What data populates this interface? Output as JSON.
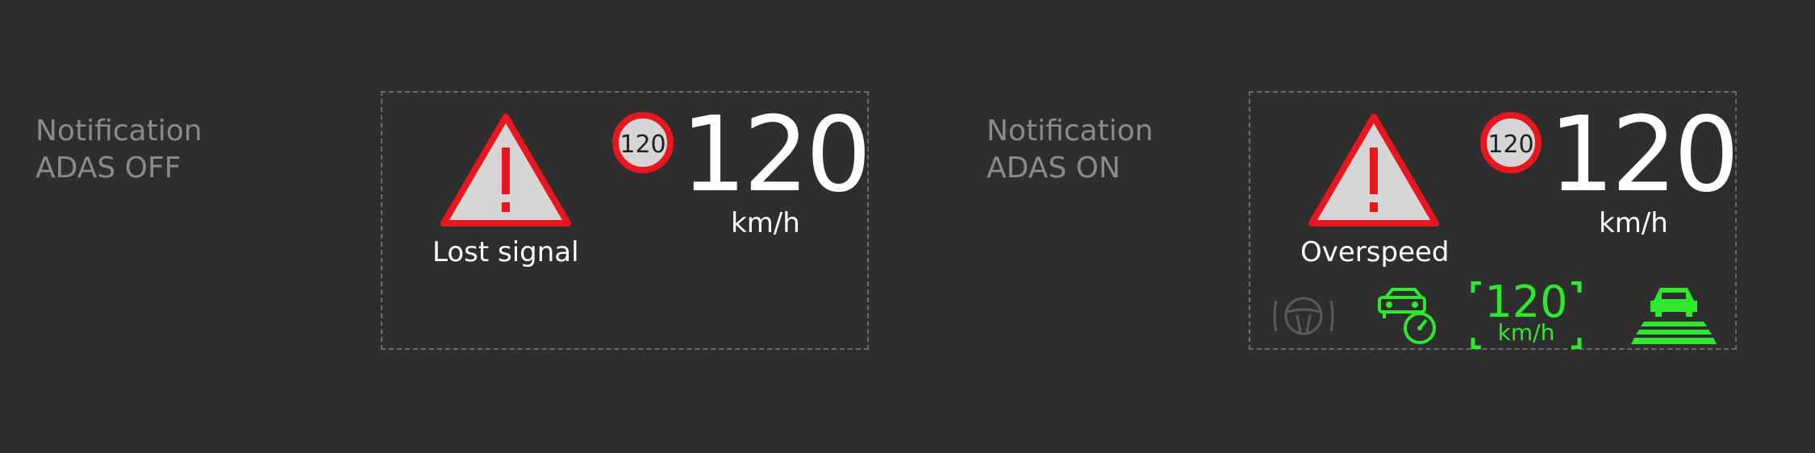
{
  "colors": {
    "background": "#2e2e2e",
    "label_gray": "#8a8a8a",
    "warning_red": "#e8161e",
    "warning_fill": "#d6d6d6",
    "text_white": "#ffffff",
    "active_green": "#2ee82e",
    "inactive_gray": "#5a5a5a"
  },
  "off_panel": {
    "label_line1": "Notification",
    "label_line2": "ADAS OFF",
    "warning_text": "Lost signal",
    "limit_sign": "120",
    "speed": "120",
    "speed_unit": "km/h",
    "icons": [
      "warning-triangle-icon",
      "speed-limit-sign-icon"
    ]
  },
  "on_panel": {
    "label_line1": "Notification",
    "label_line2": "ADAS ON",
    "warning_text": "Overspeed",
    "limit_sign": "120",
    "speed": "120",
    "speed_unit": "km/h",
    "adas": {
      "acc_speed": "120",
      "acc_unit": "km/h",
      "icons": [
        "steering-assist-icon",
        "cruise-control-icon",
        "adaptive-cruise-bracket-icon",
        "lane-keep-icon"
      ],
      "steering_assist_active": false,
      "cruise_control_active": true,
      "lane_keep_active": true
    }
  }
}
